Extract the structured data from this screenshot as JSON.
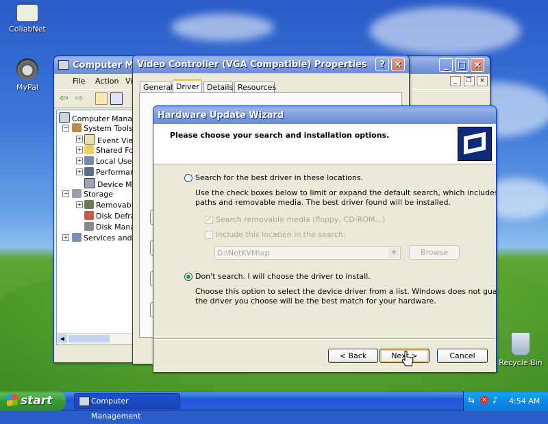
{
  "desktop": {
    "icons": [
      {
        "label": "CollabNet",
        "icon": "collabnet-icon"
      },
      {
        "label": "MyPal",
        "icon": "mypal-raccoon-icon"
      },
      {
        "label": "Recycle Bin",
        "icon": "recycle-bin-icon"
      }
    ]
  },
  "computer_management": {
    "title": "Computer Management",
    "menu": [
      "File",
      "Action",
      "View"
    ],
    "tree": [
      {
        "label": "Computer Management (Local)",
        "icon": "computer-icon"
      },
      {
        "label": "System Tools",
        "icon": "tools-icon"
      },
      {
        "label": "Event Viewer",
        "icon": "event-viewer-icon"
      },
      {
        "label": "Shared Folders",
        "icon": "shared-folder-icon"
      },
      {
        "label": "Local Users and Groups",
        "icon": "users-icon"
      },
      {
        "label": "Performance Logs and Alerts",
        "icon": "performance-icon"
      },
      {
        "label": "Device Manager",
        "icon": "device-manager-icon"
      },
      {
        "label": "Storage",
        "icon": "storage-icon"
      },
      {
        "label": "Removable Storage",
        "icon": "removable-storage-icon"
      },
      {
        "label": "Disk Defragmenter",
        "icon": "defrag-icon"
      },
      {
        "label": "Disk Management",
        "icon": "disk-management-icon"
      },
      {
        "label": "Services and Applications",
        "icon": "services-icon"
      }
    ]
  },
  "properties": {
    "title": "Video Controller (VGA Compatible) Properties",
    "tabs": [
      "General",
      "Driver",
      "Details",
      "Resources"
    ],
    "active_tab": "Driver"
  },
  "wizard": {
    "title": "Hardware Update Wizard",
    "heading": "Please choose your search and installation options.",
    "option_search": {
      "label": "Search for the best driver in these locations.",
      "selected": false,
      "description_line1": "Use the check boxes below to limit or expand the default search, which includes local",
      "description_line2": "paths and removable media. The best driver found will be installed.",
      "check_removable": {
        "label": "Search removable media (floppy, CD-ROM...)",
        "checked": true
      },
      "check_location": {
        "label": "Include this location in the search:",
        "checked": false
      },
      "path_value": "D:\\NetKVM\\xp",
      "browse_label": "Browse"
    },
    "option_dont_search": {
      "label": "Don't search. I will choose the driver to install.",
      "selected": true,
      "description_line1": "Choose this option to select the device driver from a list.  Windows does not guarantee that",
      "description_line2": "the driver you choose will be the best match for your hardware."
    },
    "buttons": {
      "back": "< Back",
      "next": "Next >",
      "cancel": "Cancel"
    }
  },
  "taskbar": {
    "start_label": "start",
    "task_label": "Computer Management",
    "clock": "4:54 AM"
  }
}
